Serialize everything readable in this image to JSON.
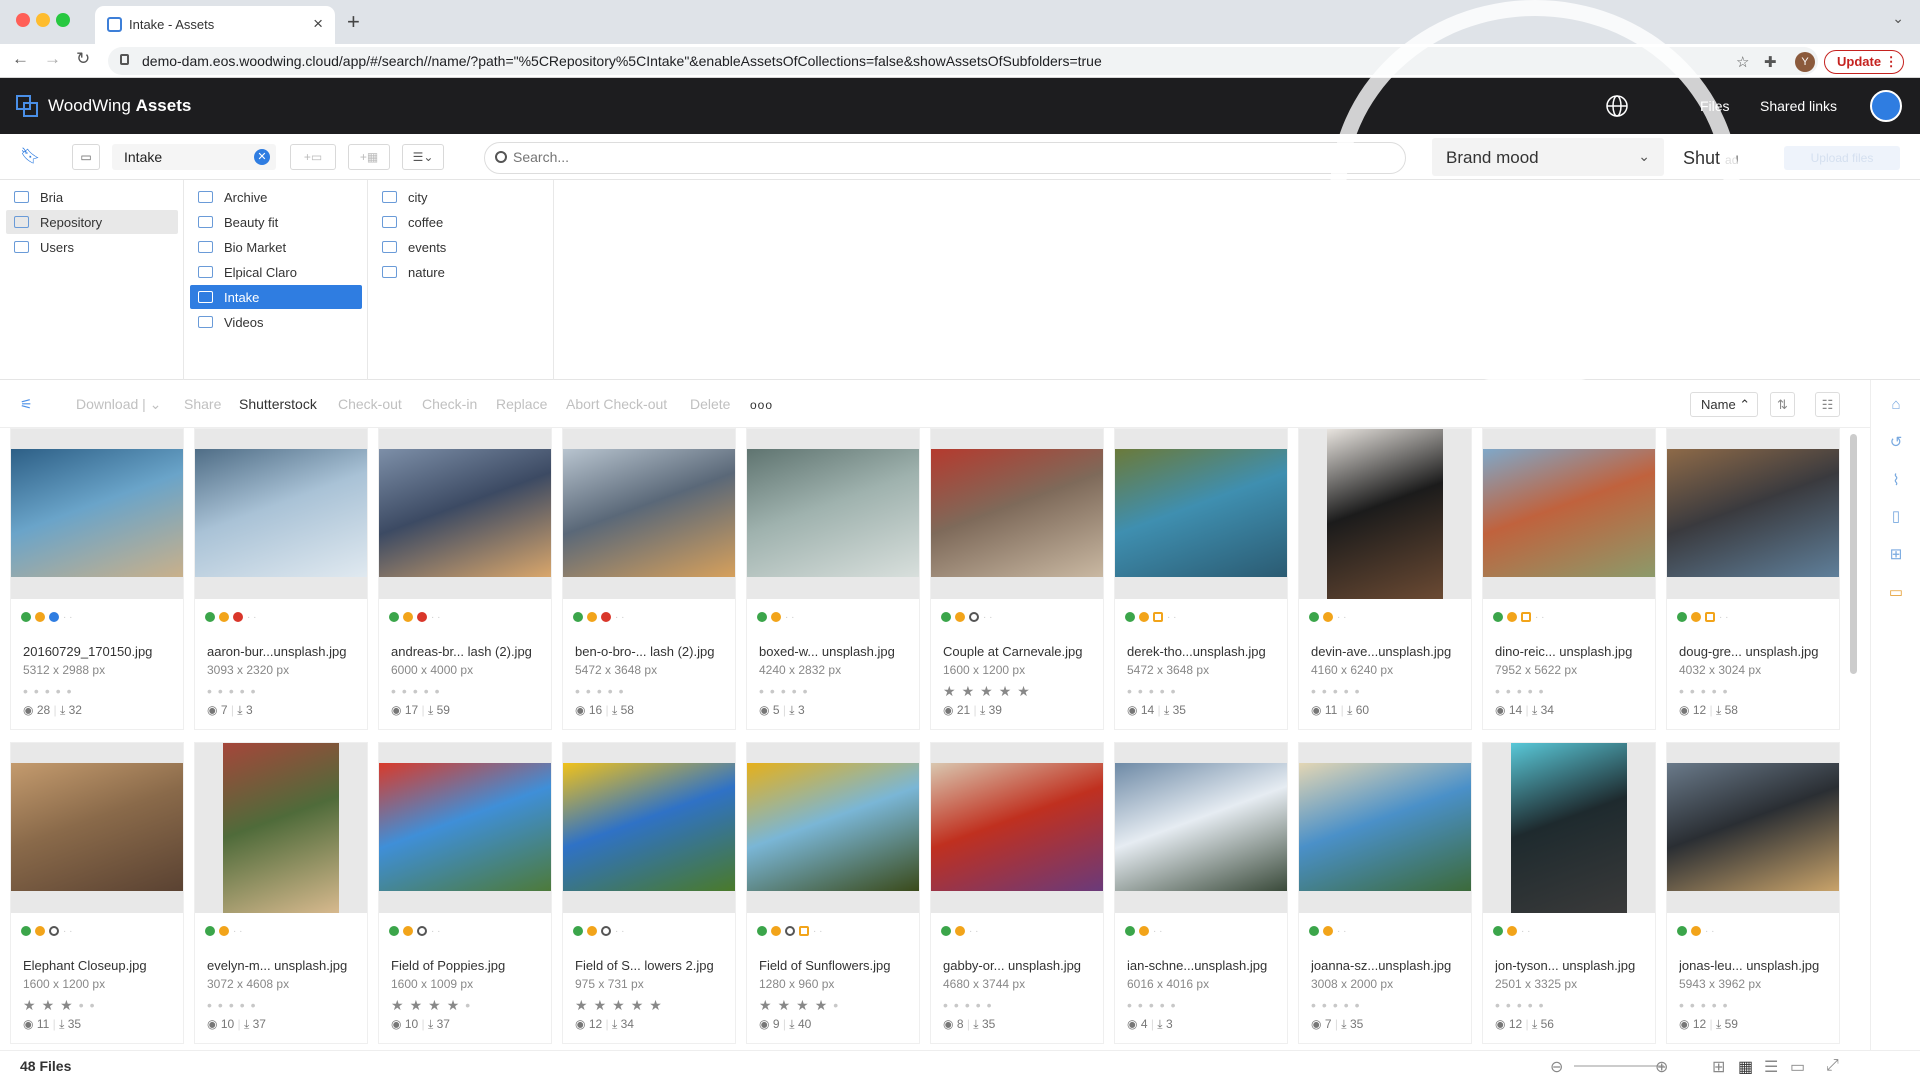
{
  "browser": {
    "tab_title": "Intake - Assets",
    "url": "demo-dam.eos.woodwing.cloud/app/#/search//name/?path=\"%5CRepository%5CIntake\"&enableAssetsOfCollections=false&showAssetsOfSubfolders=true",
    "profile_initial": "Y",
    "update_label": "Update"
  },
  "header": {
    "brand_light": "WoodWing ",
    "brand_bold": "Assets",
    "files_link": "Files",
    "shared_links": "Shared links"
  },
  "toolbar": {
    "path_value": "Intake",
    "search_placeholder": "Search...",
    "brand_mood": "Brand mood",
    "shutterstock_partial": "Shut",
    "upload_partial": "ad",
    "upload_label": "Upload files"
  },
  "folders": {
    "col1": [
      "Bria",
      "Repository",
      "Users"
    ],
    "col2": [
      "Archive",
      "Beauty fit",
      "Bio Market",
      "Elpical Claro",
      "Intake",
      "Videos"
    ],
    "col3": [
      "city",
      "coffee",
      "events",
      "nature"
    ]
  },
  "actions": {
    "download": "Download",
    "share": "Share",
    "shutterstock": "Shutterstock",
    "checkout": "Check-out",
    "checkin": "Check-in",
    "replace": "Replace",
    "abort": "Abort Check-out",
    "delete": "Delete",
    "more": "ooo",
    "sort": "Name"
  },
  "assets": [
    {
      "name": "20160729_170150.jpg",
      "dims": "5312 x 2988 px",
      "views": "28",
      "downloads": "32",
      "rating": 0,
      "colors": [
        "#6aa4c9",
        "#2d5f86",
        "#c9b08a"
      ]
    },
    {
      "name": "aaron-bur...unsplash.jpg",
      "dims": "3093 x 2320 px",
      "views": "7",
      "downloads": "3",
      "rating": 0,
      "colors": [
        "#a9c2d6",
        "#4f6d86",
        "#e0e9f0"
      ]
    },
    {
      "name": "andreas-br... lash (2).jpg",
      "dims": "6000 x 4000 px",
      "views": "17",
      "downloads": "59",
      "rating": 0,
      "colors": [
        "#3c4a63",
        "#7d8fa8",
        "#d9a66b"
      ]
    },
    {
      "name": "ben-o-bro-... lash (2).jpg",
      "dims": "5472 x 3648 px",
      "views": "16",
      "downloads": "58",
      "rating": 0,
      "colors": [
        "#5a6878",
        "#b8c4cf",
        "#d6a05c"
      ]
    },
    {
      "name": "boxed-w... unsplash.jpg",
      "dims": "4240 x 2832 px",
      "views": "5",
      "downloads": "3",
      "rating": 0,
      "colors": [
        "#9fb2ae",
        "#5f7470",
        "#d8dfdc"
      ]
    },
    {
      "name": "Couple at Carnevale.jpg",
      "dims": "1600 x 1200 px",
      "views": "21",
      "downloads": "39",
      "rating": 5,
      "colors": [
        "#7e6a5a",
        "#b53a2e",
        "#c9b8a2"
      ]
    },
    {
      "name": "derek-tho...unsplash.jpg",
      "dims": "5472 x 3648 px",
      "views": "14",
      "downloads": "35",
      "rating": 0,
      "colors": [
        "#3f8fb0",
        "#6b7a3a",
        "#2b5b72"
      ]
    },
    {
      "name": "devin-ave...unsplash.jpg",
      "dims": "4160 x 6240 px",
      "views": "11",
      "downloads": "60",
      "rating": 0,
      "colors": [
        "#1b1b1b",
        "#e8e4df",
        "#6b4a33"
      ]
    },
    {
      "name": "dino-reic... unsplash.jpg",
      "dims": "7952 x 5622 px",
      "views": "14",
      "downloads": "34",
      "rating": 0,
      "colors": [
        "#c0623d",
        "#7fa8c9",
        "#8c9a6a"
      ]
    },
    {
      "name": "doug-gre... unsplash.jpg",
      "dims": "4032 x 3024 px",
      "views": "12",
      "downloads": "58",
      "rating": 0,
      "colors": [
        "#3a3a3e",
        "#8e6a48",
        "#5f7f9a"
      ]
    },
    {
      "name": "Elephant Closeup.jpg",
      "dims": "1600 x 1200 px",
      "views": "11",
      "downloads": "35",
      "rating": 3,
      "colors": [
        "#8a6a4a",
        "#c49b6e",
        "#5a4232"
      ]
    },
    {
      "name": "evelyn-m... unsplash.jpg",
      "dims": "3072 x 4608 px",
      "views": "10",
      "downloads": "37",
      "rating": 0,
      "colors": [
        "#4f6b3a",
        "#a5463a",
        "#d7b98e"
      ]
    },
    {
      "name": "Field of Poppies.jpg",
      "dims": "1600 x 1009 px",
      "views": "10",
      "downloads": "37",
      "rating": 4,
      "colors": [
        "#3f8fd8",
        "#d93a2a",
        "#4d7a3a"
      ]
    },
    {
      "name": "Field of S... lowers 2.jpg",
      "dims": "975 x 731 px",
      "views": "12",
      "downloads": "34",
      "rating": 5,
      "colors": [
        "#2f72c6",
        "#f1c21a",
        "#4a7a2a"
      ]
    },
    {
      "name": "Field of Sunflowers.jpg",
      "dims": "1280 x 960 px",
      "views": "9",
      "downloads": "40",
      "rating": 4,
      "colors": [
        "#7ab6d6",
        "#e6b01a",
        "#3a4a1a"
      ]
    },
    {
      "name": "gabby-or... unsplash.jpg",
      "dims": "4680 x 3744 px",
      "views": "8",
      "downloads": "35",
      "rating": 0,
      "colors": [
        "#c0301f",
        "#d9c7b0",
        "#6a3a7a"
      ]
    },
    {
      "name": "ian-schne...unsplash.jpg",
      "dims": "6016 x 4016 px",
      "views": "4",
      "downloads": "3",
      "rating": 0,
      "colors": [
        "#e6ecf2",
        "#6e8aa6",
        "#3a4a3a"
      ]
    },
    {
      "name": "joanna-sz...unsplash.jpg",
      "dims": "3008 x 2000 px",
      "views": "7",
      "downloads": "35",
      "rating": 0,
      "colors": [
        "#4a90c8",
        "#e3d6b4",
        "#3c6a3a"
      ]
    },
    {
      "name": "jon-tyson... unsplash.jpg",
      "dims": "2501 x 3325 px",
      "views": "12",
      "downloads": "56",
      "rating": 0,
      "colors": [
        "#1e2a2e",
        "#59c8d8",
        "#3a3a3a"
      ]
    },
    {
      "name": "jonas-leu... unsplash.jpg",
      "dims": "5943 x 3962 px",
      "views": "12",
      "downloads": "59",
      "rating": 0,
      "colors": [
        "#2a2e33",
        "#6a7a8a",
        "#c9a36a"
      ]
    }
  ],
  "status": {
    "count": "48 Files"
  },
  "icons": {
    "tag_green": "#3ba54a",
    "tag_orange": "#f2a41a",
    "tag_blue": "#2f7de1",
    "tag_red": "#d9362a",
    "accent": "#2f7de1"
  }
}
